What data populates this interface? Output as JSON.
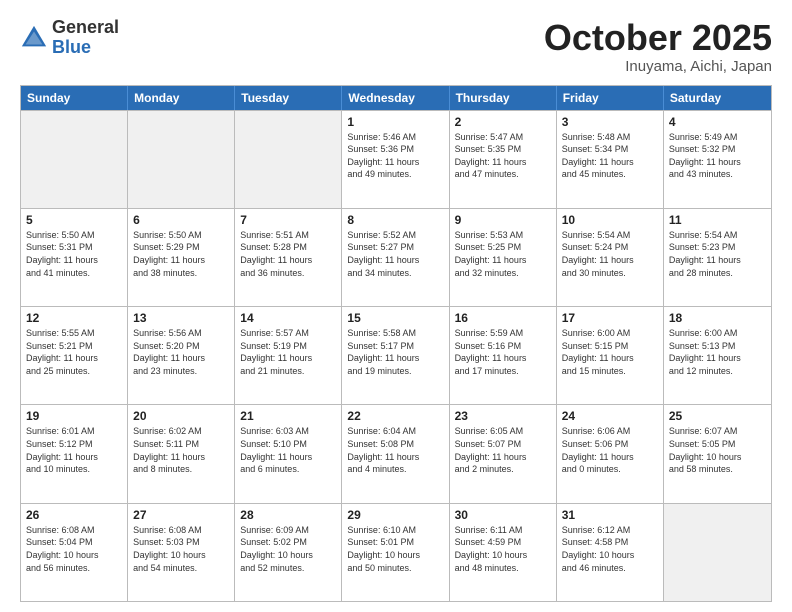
{
  "header": {
    "logo_general": "General",
    "logo_blue": "Blue",
    "month_title": "October 2025",
    "location": "Inuyama, Aichi, Japan"
  },
  "weekdays": [
    "Sunday",
    "Monday",
    "Tuesday",
    "Wednesday",
    "Thursday",
    "Friday",
    "Saturday"
  ],
  "rows": [
    [
      {
        "day": "",
        "text": ""
      },
      {
        "day": "",
        "text": ""
      },
      {
        "day": "",
        "text": ""
      },
      {
        "day": "1",
        "text": "Sunrise: 5:46 AM\nSunset: 5:36 PM\nDaylight: 11 hours\nand 49 minutes."
      },
      {
        "day": "2",
        "text": "Sunrise: 5:47 AM\nSunset: 5:35 PM\nDaylight: 11 hours\nand 47 minutes."
      },
      {
        "day": "3",
        "text": "Sunrise: 5:48 AM\nSunset: 5:34 PM\nDaylight: 11 hours\nand 45 minutes."
      },
      {
        "day": "4",
        "text": "Sunrise: 5:49 AM\nSunset: 5:32 PM\nDaylight: 11 hours\nand 43 minutes."
      }
    ],
    [
      {
        "day": "5",
        "text": "Sunrise: 5:50 AM\nSunset: 5:31 PM\nDaylight: 11 hours\nand 41 minutes."
      },
      {
        "day": "6",
        "text": "Sunrise: 5:50 AM\nSunset: 5:29 PM\nDaylight: 11 hours\nand 38 minutes."
      },
      {
        "day": "7",
        "text": "Sunrise: 5:51 AM\nSunset: 5:28 PM\nDaylight: 11 hours\nand 36 minutes."
      },
      {
        "day": "8",
        "text": "Sunrise: 5:52 AM\nSunset: 5:27 PM\nDaylight: 11 hours\nand 34 minutes."
      },
      {
        "day": "9",
        "text": "Sunrise: 5:53 AM\nSunset: 5:25 PM\nDaylight: 11 hours\nand 32 minutes."
      },
      {
        "day": "10",
        "text": "Sunrise: 5:54 AM\nSunset: 5:24 PM\nDaylight: 11 hours\nand 30 minutes."
      },
      {
        "day": "11",
        "text": "Sunrise: 5:54 AM\nSunset: 5:23 PM\nDaylight: 11 hours\nand 28 minutes."
      }
    ],
    [
      {
        "day": "12",
        "text": "Sunrise: 5:55 AM\nSunset: 5:21 PM\nDaylight: 11 hours\nand 25 minutes."
      },
      {
        "day": "13",
        "text": "Sunrise: 5:56 AM\nSunset: 5:20 PM\nDaylight: 11 hours\nand 23 minutes."
      },
      {
        "day": "14",
        "text": "Sunrise: 5:57 AM\nSunset: 5:19 PM\nDaylight: 11 hours\nand 21 minutes."
      },
      {
        "day": "15",
        "text": "Sunrise: 5:58 AM\nSunset: 5:17 PM\nDaylight: 11 hours\nand 19 minutes."
      },
      {
        "day": "16",
        "text": "Sunrise: 5:59 AM\nSunset: 5:16 PM\nDaylight: 11 hours\nand 17 minutes."
      },
      {
        "day": "17",
        "text": "Sunrise: 6:00 AM\nSunset: 5:15 PM\nDaylight: 11 hours\nand 15 minutes."
      },
      {
        "day": "18",
        "text": "Sunrise: 6:00 AM\nSunset: 5:13 PM\nDaylight: 11 hours\nand 12 minutes."
      }
    ],
    [
      {
        "day": "19",
        "text": "Sunrise: 6:01 AM\nSunset: 5:12 PM\nDaylight: 11 hours\nand 10 minutes."
      },
      {
        "day": "20",
        "text": "Sunrise: 6:02 AM\nSunset: 5:11 PM\nDaylight: 11 hours\nand 8 minutes."
      },
      {
        "day": "21",
        "text": "Sunrise: 6:03 AM\nSunset: 5:10 PM\nDaylight: 11 hours\nand 6 minutes."
      },
      {
        "day": "22",
        "text": "Sunrise: 6:04 AM\nSunset: 5:08 PM\nDaylight: 11 hours\nand 4 minutes."
      },
      {
        "day": "23",
        "text": "Sunrise: 6:05 AM\nSunset: 5:07 PM\nDaylight: 11 hours\nand 2 minutes."
      },
      {
        "day": "24",
        "text": "Sunrise: 6:06 AM\nSunset: 5:06 PM\nDaylight: 11 hours\nand 0 minutes."
      },
      {
        "day": "25",
        "text": "Sunrise: 6:07 AM\nSunset: 5:05 PM\nDaylight: 10 hours\nand 58 minutes."
      }
    ],
    [
      {
        "day": "26",
        "text": "Sunrise: 6:08 AM\nSunset: 5:04 PM\nDaylight: 10 hours\nand 56 minutes."
      },
      {
        "day": "27",
        "text": "Sunrise: 6:08 AM\nSunset: 5:03 PM\nDaylight: 10 hours\nand 54 minutes."
      },
      {
        "day": "28",
        "text": "Sunrise: 6:09 AM\nSunset: 5:02 PM\nDaylight: 10 hours\nand 52 minutes."
      },
      {
        "day": "29",
        "text": "Sunrise: 6:10 AM\nSunset: 5:01 PM\nDaylight: 10 hours\nand 50 minutes."
      },
      {
        "day": "30",
        "text": "Sunrise: 6:11 AM\nSunset: 4:59 PM\nDaylight: 10 hours\nand 48 minutes."
      },
      {
        "day": "31",
        "text": "Sunrise: 6:12 AM\nSunset: 4:58 PM\nDaylight: 10 hours\nand 46 minutes."
      },
      {
        "day": "",
        "text": ""
      }
    ]
  ]
}
